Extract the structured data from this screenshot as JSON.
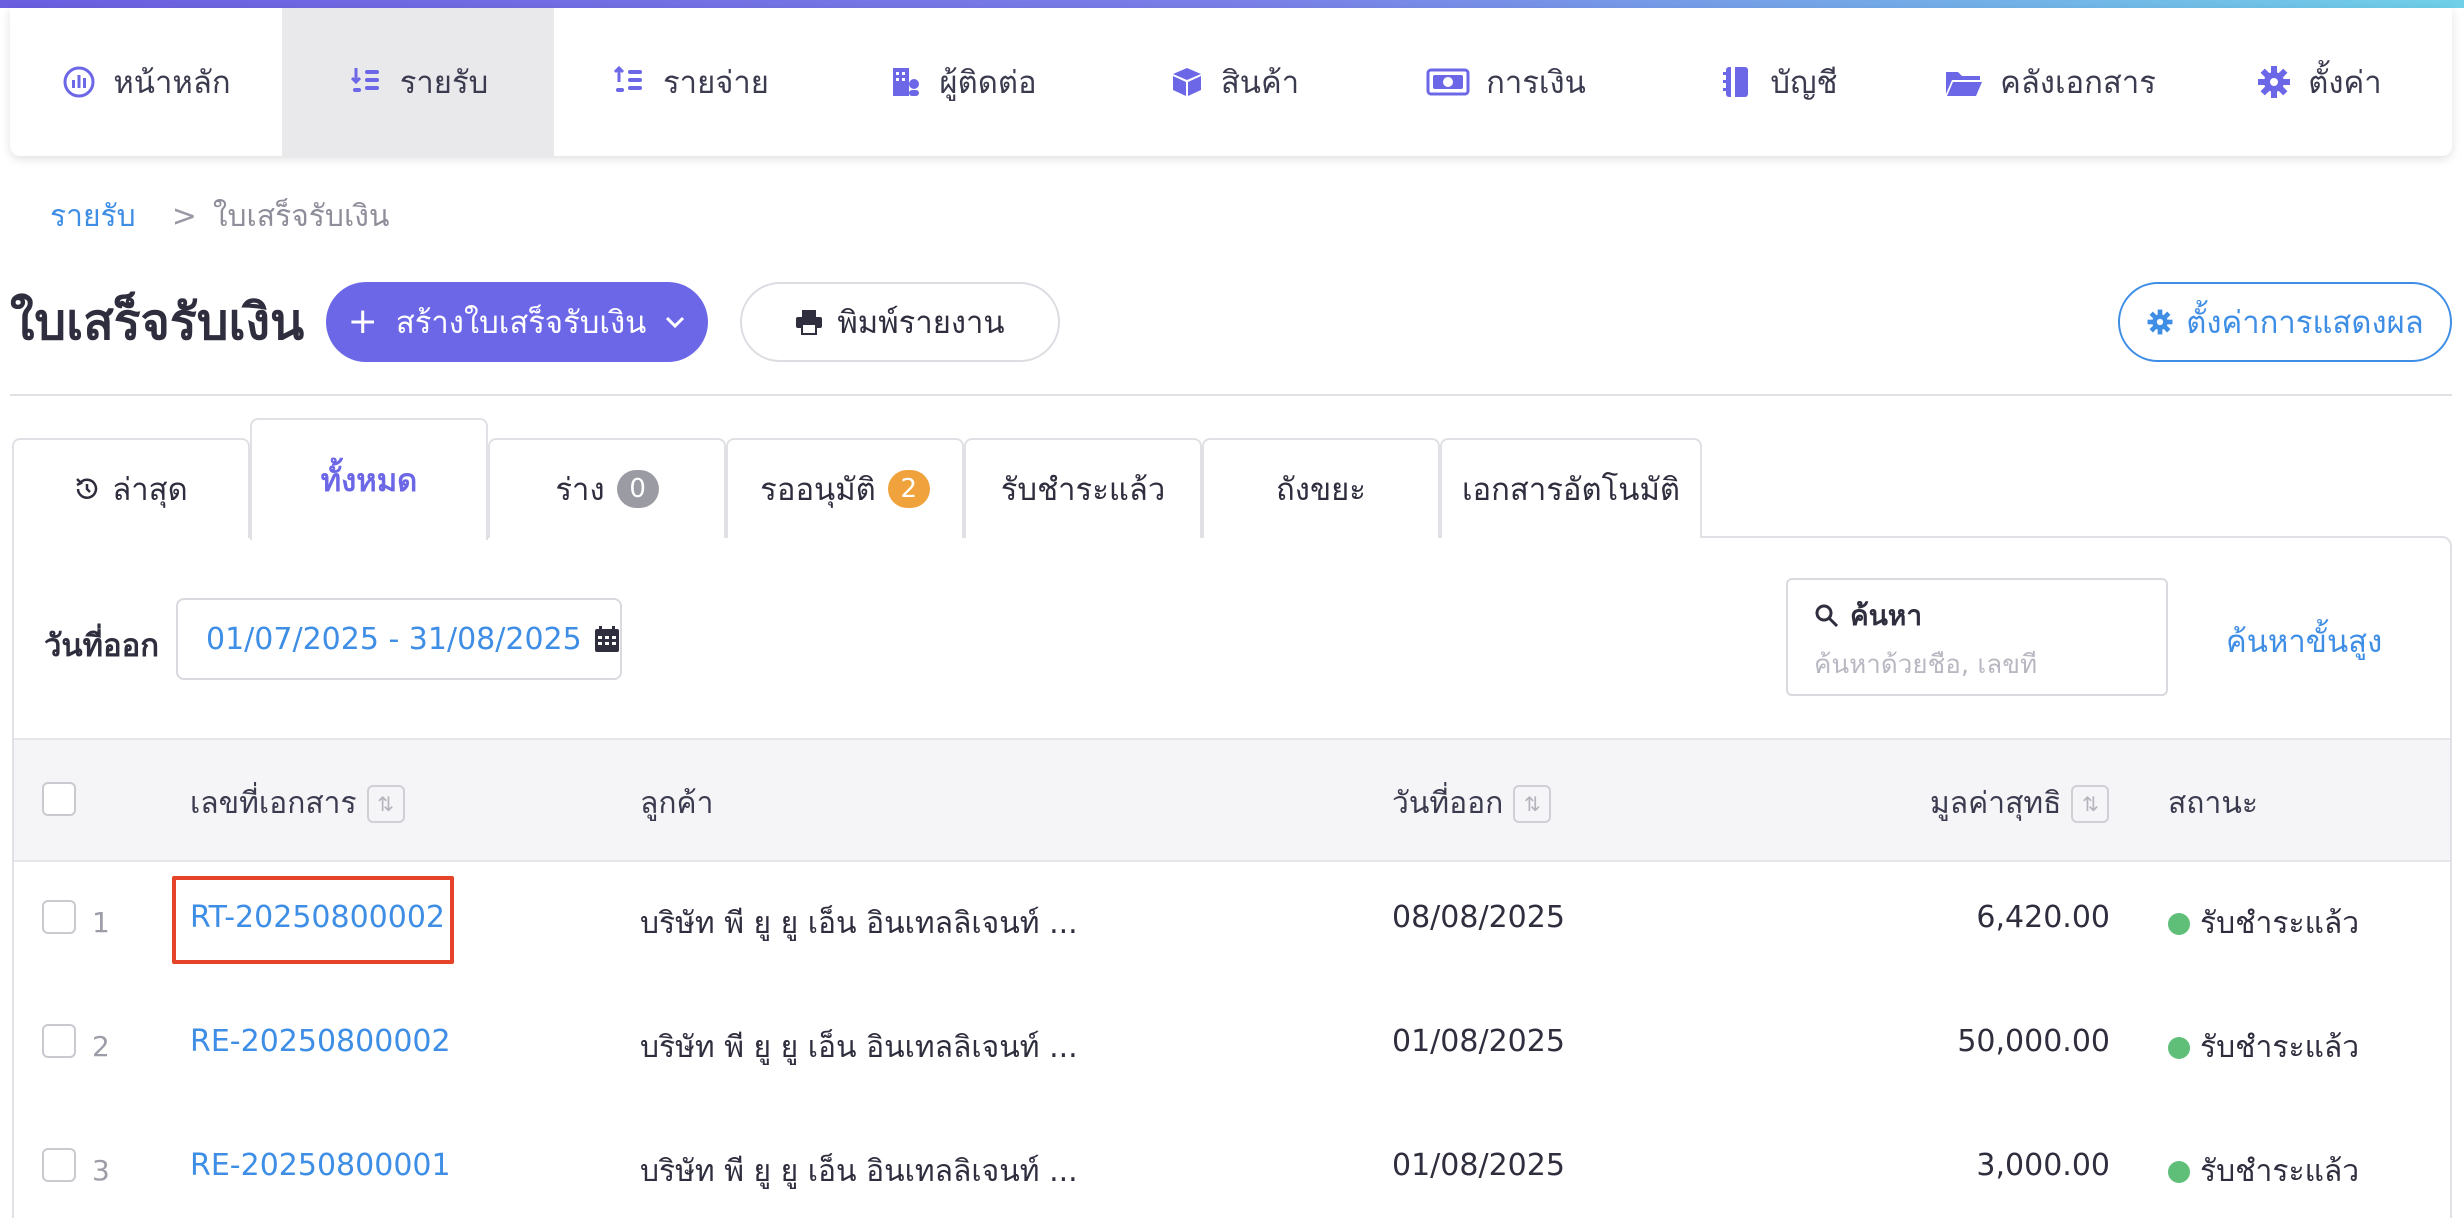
{
  "nav": {
    "items": [
      {
        "label": "หน้าหลัก",
        "icon": "dashboard-icon"
      },
      {
        "label": "รายรับ",
        "icon": "income-icon"
      },
      {
        "label": "รายจ่าย",
        "icon": "expense-icon"
      },
      {
        "label": "ผู้ติดต่อ",
        "icon": "contacts-icon"
      },
      {
        "label": "สินค้า",
        "icon": "box-icon"
      },
      {
        "label": "การเงิน",
        "icon": "money-icon"
      },
      {
        "label": "บัญชี",
        "icon": "ledger-icon"
      },
      {
        "label": "คลังเอกสาร",
        "icon": "folder-icon"
      },
      {
        "label": "ตั้งค่า",
        "icon": "gear-icon"
      }
    ],
    "active_index": 1
  },
  "breadcrumb": {
    "parent": "รายรับ",
    "separator": ">",
    "current": "ใบเสร็จรับเงิน"
  },
  "header": {
    "title": "ใบเสร็จรับเงิน",
    "create_button": "สร้างใบเสร็จรับเงิน",
    "print_button": "พิมพ์รายงาน",
    "settings_button": "ตั้งค่าการแสดงผล"
  },
  "tabs": [
    {
      "label": "ล่าสุด"
    },
    {
      "label": "ทั้งหมด",
      "active": true
    },
    {
      "label": "ร่าง",
      "badge": "0"
    },
    {
      "label": "รออนุมัติ",
      "badge": "2"
    },
    {
      "label": "รับชำระแล้ว"
    },
    {
      "label": "ถังขยะ"
    },
    {
      "label": "เอกสารอัตโนมัติ"
    }
  ],
  "filter": {
    "date_label": "วันที่ออก",
    "date_range": "01/07/2025 - 31/08/2025",
    "search_title": "ค้นหา",
    "search_placeholder": "ค้นหาด้วยชื่อ, เลขที่",
    "advanced_search": "ค้นหาขั้นสูง"
  },
  "table": {
    "columns": {
      "doc_no": "เลขที่เอกสาร",
      "customer": "ลูกค้า",
      "issue_date": "วันที่ออก",
      "net_amount": "มูลค่าสุทธิ",
      "status": "สถานะ"
    },
    "rows": [
      {
        "num": "1",
        "doc_no": "RT-20250800002",
        "customer": "บริษัท พี ยู ยู เอ็น อินเทลลิเจนท์ ...",
        "issue_date": "08/08/2025",
        "amount": "6,420.00",
        "status": "รับชำระแล้ว"
      },
      {
        "num": "2",
        "doc_no": "RE-20250800002",
        "customer": "บริษัท พี ยู ยู เอ็น อินเทลลิเจนท์ ...",
        "issue_date": "01/08/2025",
        "amount": "50,000.00",
        "status": "รับชำระแล้ว"
      },
      {
        "num": "3",
        "doc_no": "RE-20250800001",
        "customer": "บริษัท พี ยู ยู เอ็น อินเทลลิเจนท์ ...",
        "issue_date": "01/08/2025",
        "amount": "3,000.00",
        "status": "รับชำระแล้ว"
      }
    ]
  },
  "colors": {
    "accent": "#6c67e6",
    "link": "#3f8ee6",
    "status_paid": "#5fbf78",
    "highlight": "#e5442b"
  }
}
